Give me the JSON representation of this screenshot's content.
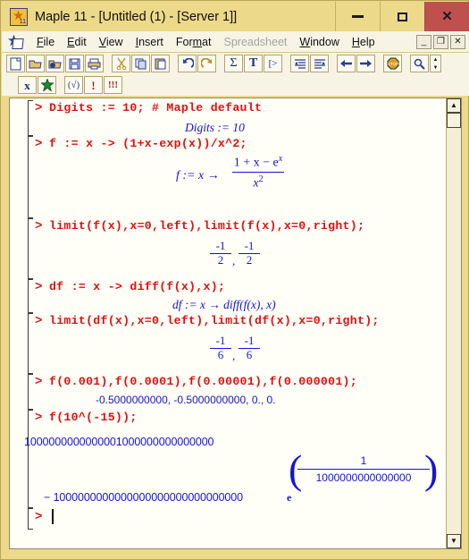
{
  "window": {
    "title": "Maple 11  - [Untitled (1) - [Server 1]]",
    "icon": "maple-leaf-icon",
    "buttons": {
      "minimize": "minimize-icon",
      "maximize": "maximize-icon",
      "close": "close-icon"
    },
    "accent_titlebar": "#ecd98a",
    "accent_close": "#c0504d"
  },
  "menubar": {
    "doc_icon": "maple-document-icon",
    "items": [
      {
        "label": "File",
        "disabled": false
      },
      {
        "label": "Edit",
        "disabled": false
      },
      {
        "label": "View",
        "disabled": false
      },
      {
        "label": "Insert",
        "disabled": false
      },
      {
        "label": "Format",
        "disabled": false
      },
      {
        "label": "Spreadsheet",
        "disabled": true
      },
      {
        "label": "Window",
        "disabled": false
      },
      {
        "label": "Help",
        "disabled": false
      }
    ],
    "mdi_buttons": [
      "_",
      "❐",
      "✕"
    ]
  },
  "toolbar": {
    "row1": [
      {
        "name": "new-document-icon",
        "glyph": "⬜"
      },
      {
        "name": "open-file-icon",
        "glyph": "📂"
      },
      {
        "name": "open-url-icon",
        "glyph": "🌐"
      },
      {
        "name": "save-icon",
        "glyph": "💾"
      },
      {
        "name": "print-icon",
        "glyph": "🖨"
      },
      {
        "name": "cut-icon",
        "glyph": "✂"
      },
      {
        "name": "copy-icon",
        "glyph": "⧉"
      },
      {
        "name": "paste-icon",
        "glyph": "📋"
      },
      {
        "name": "undo-icon",
        "glyph": "↶"
      },
      {
        "name": "redo-icon",
        "glyph": "↷"
      },
      {
        "name": "sum-math-icon",
        "glyph": "Σ"
      },
      {
        "name": "text-mode-icon",
        "glyph": "T"
      },
      {
        "name": "input-prompt-icon",
        "glyph": "[>"
      },
      {
        "name": "outdent-icon",
        "glyph": "≡"
      },
      {
        "name": "indent-icon",
        "glyph": "≡"
      },
      {
        "name": "back-arrow-icon",
        "glyph": "←"
      },
      {
        "name": "forward-arrow-icon",
        "glyph": "→"
      },
      {
        "name": "stop-icon",
        "glyph": "⬣"
      },
      {
        "name": "zoom-icon",
        "glyph": "🔍"
      },
      {
        "name": "zoom-spinner",
        "glyph": "▲▼"
      }
    ],
    "row2": [
      {
        "name": "math-x-icon",
        "glyph": "x"
      },
      {
        "name": "maple-leaf-icon",
        "glyph": "☘"
      },
      {
        "name": "check-syntax-icon",
        "glyph": "(√)"
      },
      {
        "name": "execute-icon",
        "glyph": "!"
      },
      {
        "name": "execute-all-icon",
        "glyph": "!!!"
      }
    ]
  },
  "worksheet": {
    "prompt_symbol": ">",
    "colors": {
      "input": "#e01010",
      "output": "#1414d8",
      "background": "#fffef7"
    },
    "groups": [
      {
        "id": "group-1",
        "input": "Digits := 10; # Maple default",
        "output_text": "Digits := 10",
        "output_kind": "inline"
      },
      {
        "id": "group-2",
        "input": "f := x -> (1+x-exp(x))/x^2;",
        "output_kind": "fraction-function",
        "output_prefix": "f := x →",
        "output_numerator": "1 + x − e",
        "output_numerator_exp": "x",
        "output_denominator": "x",
        "output_denominator_exp": "2"
      },
      {
        "id": "group-3",
        "input": "limit(f(x),x=0,left),limit(f(x),x=0,right);",
        "output_kind": "two-fractions",
        "frac1_num": "-1",
        "frac1_den": "2",
        "separator": ",",
        "frac2_num": "-1",
        "frac2_den": "2"
      },
      {
        "id": "group-4",
        "input": "df := x -> diff(f(x),x);",
        "output_kind": "inline",
        "output_text": "df := x → diff(f(x), x)"
      },
      {
        "id": "group-5",
        "input": "limit(df(x),x=0,left),limit(df(x),x=0,right);",
        "output_kind": "two-fractions",
        "frac1_num": "-1",
        "frac1_den": "6",
        "separator": ",",
        "frac2_num": "-1",
        "frac2_den": "6"
      },
      {
        "id": "group-6",
        "input": "f(0.001),f(0.0001),f(0.00001),f(0.000001);",
        "output_kind": "inline",
        "output_text": "-0.5000000000, -0.5000000000, 0., 0."
      },
      {
        "id": "group-7",
        "input": "f(10^(-15));",
        "output_kind": "bignum",
        "line1": "1000000000000001000000000000000",
        "line2_prefix": "− 1000000000000000000000000000000",
        "line2_base": "e",
        "exp_numerator": "1",
        "exp_denominator": "1000000000000000"
      },
      {
        "id": "group-8",
        "input": "",
        "output_kind": "empty-cursor"
      }
    ]
  },
  "scrollbar": {
    "up_arrow": "scroll-up-icon",
    "down_arrow": "scroll-down-icon",
    "thumb": "scroll-thumb"
  }
}
